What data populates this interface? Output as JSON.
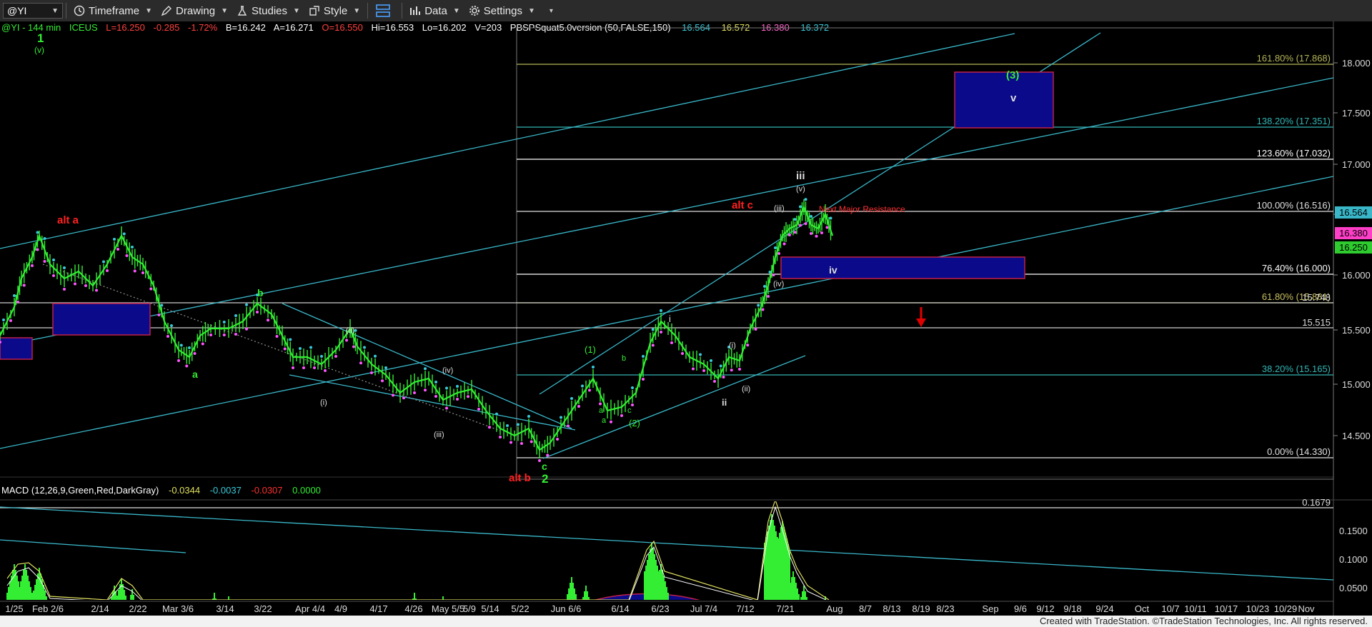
{
  "toolbar": {
    "symbol": "@YI",
    "timeframe": "Timeframe",
    "drawing": "Drawing",
    "studies": "Studies",
    "style": "Style",
    "data": "Data",
    "settings": "Settings"
  },
  "header": {
    "symbol_info": "@YI - 144 min",
    "exchange": "ICEUS",
    "last": "L=16.250",
    "change": "-0.285",
    "change_pct": "-1.72%",
    "bid": "B=16.242",
    "ask": "A=16.271",
    "open": "O=16.550",
    "high": "Hi=16.553",
    "low": "Lo=16.202",
    "volume": "V=203",
    "study_name": "PBSPSquat5.0version (50,FALSE,150)",
    "study_values": [
      "16.564",
      "16.572",
      "16.380",
      "16.372"
    ]
  },
  "macd_header": {
    "name": "MACD (12,26,9,Green,Red,DarkGray)",
    "values": [
      "-0.0344",
      "-0.0037",
      "-0.0307",
      "0.0000"
    ]
  },
  "price_axis": {
    "ticks": [
      "18.000",
      "17.500",
      "17.000",
      "16.500",
      "16.000",
      "15.500",
      "15.000",
      "14.500"
    ],
    "tags": [
      "16.564",
      "16.380",
      "16.250"
    ]
  },
  "macd_axis": {
    "ticks": [
      "0.1500",
      "0.1000",
      "0.0500"
    ]
  },
  "fib_levels": [
    {
      "label": "161.80% (17.868)",
      "color": "#b5b55a"
    },
    {
      "label": "138.20% (17.351)",
      "color": "#33b5b5"
    },
    {
      "label": "123.60% (17.032)",
      "color": "#ffffff"
    },
    {
      "label": "100.00% (16.516)",
      "color": "#e0e0e0"
    },
    {
      "label": "76.40% (16.000)",
      "color": "#ffffff"
    },
    {
      "label": "61.80% (15.881)",
      "color": "#c8c060"
    },
    {
      "label": "38.20% (15.165)",
      "color": "#33b5b5"
    },
    {
      "label": "0.00% (14.330)",
      "color": "#e0e0e0"
    }
  ],
  "extra_levels": [
    "15.748",
    "15.515",
    "0.1679"
  ],
  "annotations": {
    "wave_1": "1",
    "v_top": "(v)",
    "alt_a": "alt a",
    "wave_a": "a",
    "wave_b": "b",
    "ii_paren": "(ii)",
    "i_paren": "(i)",
    "iv_paren": "(iv)",
    "iii_paren": "(iii)",
    "alt_b": "alt b",
    "wave_c": "c",
    "wave_2": "2",
    "one_paren": "(1)",
    "sub_a1": "a",
    "sub_b": "b",
    "sub_a2": "a",
    "sub_c": "c",
    "two_paren": "(2)",
    "small_i": "i",
    "small_i_paren": "(i)",
    "ii_plain": "ii",
    "ii_paren2": "(ii)",
    "iii_paren2": "(iii)",
    "v_paren2": "(v)",
    "iii_plain": "iii",
    "iv_paren2": "(iv)",
    "iv_plain": "iv",
    "alt_c": "alt c",
    "resistance": "Next Major Resistance",
    "three_paren": "(3)",
    "v_plain": "v"
  },
  "time_axis": [
    "1/25",
    "Feb 2/6",
    "2/14",
    "2/22",
    "Mar 3/6",
    "3/14",
    "3/22",
    "Apr 4/4",
    "4/9",
    "4/17",
    "4/26",
    "May 5/5",
    "5/9",
    "5/14",
    "5/22",
    "Jun 6/6",
    "6/14",
    "6/23",
    "Jul 7/4",
    "7/12",
    "7/21",
    "Aug",
    "8/7",
    "8/13",
    "8/19",
    "8/23",
    "Sep",
    "9/6",
    "9/12",
    "9/18",
    "9/24",
    "Oct",
    "10/7",
    "10/11",
    "10/17",
    "10/23",
    "10/29",
    "Nov"
  ],
  "footer": "Created with TradeStation. ©TradeStation Technologies, Inc. All rights reserved.",
  "colors": {
    "green": "#33ee33",
    "red": "#e00000",
    "cyan": "#39b7c9",
    "blue_box": "#0a0a8a"
  }
}
